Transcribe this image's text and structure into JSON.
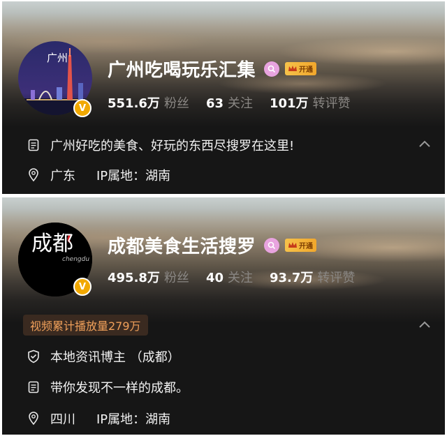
{
  "colors": {
    "card_bg": "#161616",
    "verified": "#f1a800",
    "search_badge": "#e8a3df",
    "vip_gold": "#f6c24a",
    "play_tag_text": "#f0a05a"
  },
  "cards": [
    {
      "avatar_text": "广州",
      "name": "广州吃喝玩乐汇集",
      "vip_label": "开通",
      "verified_mark": "V",
      "stats": [
        {
          "value": "551.6万",
          "label": "粉丝"
        },
        {
          "value": "63",
          "label": "关注"
        },
        {
          "value": "101万",
          "label": "转评赞"
        }
      ],
      "bio": "广州好吃的美食、好玩的东西尽搜罗在这里!",
      "location": "广东",
      "ip_location": "IP属地：湖南",
      "icons": [
        "document-icon",
        "location-pin-icon",
        "chevron-up-icon",
        "search-icon",
        "crown-icon",
        "verified-icon"
      ]
    },
    {
      "avatar_text": "成都",
      "avatar_subtext": "chengdu",
      "name": "成都美食生活搜罗",
      "vip_label": "开通",
      "verified_mark": "V",
      "stats": [
        {
          "value": "495.8万",
          "label": "粉丝"
        },
        {
          "value": "40",
          "label": "关注"
        },
        {
          "value": "93.7万",
          "label": "转评赞"
        }
      ],
      "play_count": "视频累计播放量279万",
      "tag": "本地资讯博主 （成都）",
      "bio": "带你发现不一样的成都。",
      "location": "四川",
      "ip_location": "IP属地：湖南",
      "icons": [
        "shield-icon",
        "document-icon",
        "location-pin-icon",
        "chevron-up-icon",
        "search-icon",
        "crown-icon",
        "verified-icon"
      ]
    }
  ]
}
